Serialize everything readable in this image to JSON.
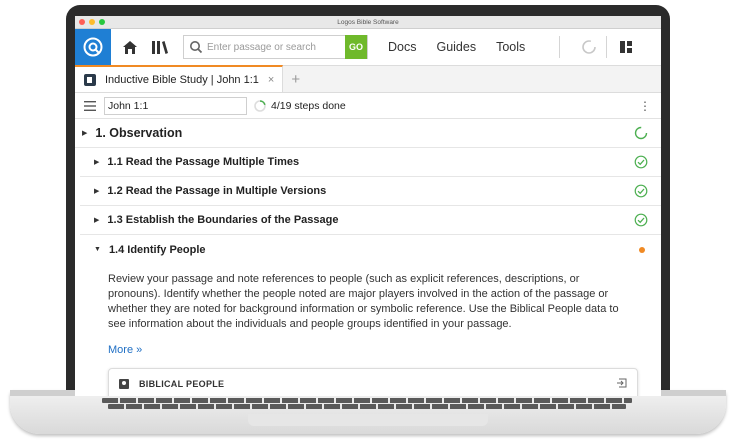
{
  "window": {
    "title": "Logos Bible Software"
  },
  "toolbar": {
    "search_placeholder": "Enter passage or search",
    "go_label": "GO",
    "docs": "Docs",
    "guides": "Guides",
    "tools": "Tools"
  },
  "tab": {
    "label": "Inductive Bible Study | John 1:1",
    "close": "×",
    "add": "+"
  },
  "docbar": {
    "reference": "John 1:1",
    "progress": "4/19 steps done",
    "progress_fraction": 0.21
  },
  "sections": [
    {
      "title": "1. Observation",
      "status": "in-progress"
    },
    {
      "title": "1.1 Read the Passage Multiple Times",
      "status": "done"
    },
    {
      "title": "1.2 Read the Passage in Multiple Versions",
      "status": "done"
    },
    {
      "title": "1.3 Establish the Boundaries of the Passage",
      "status": "done"
    },
    {
      "title": "1.4 Identify People",
      "status": "current"
    }
  ],
  "detail": {
    "text": "Review your passage and note references to people (such as explicit references, descriptions, or pronouns). Identify whether the people noted are major players involved in the action of the passage or whether they are noted for background information or symbolic reference. Use the Biblical People data to see information about the individuals and people groups identified in your passage.",
    "more": "More »",
    "panel_title": "BIBLICAL PEOPLE"
  },
  "colors": {
    "accent": "#1f7fd4",
    "go": "#6fb92b",
    "done": "#4caf50",
    "current": "#f08a24"
  }
}
